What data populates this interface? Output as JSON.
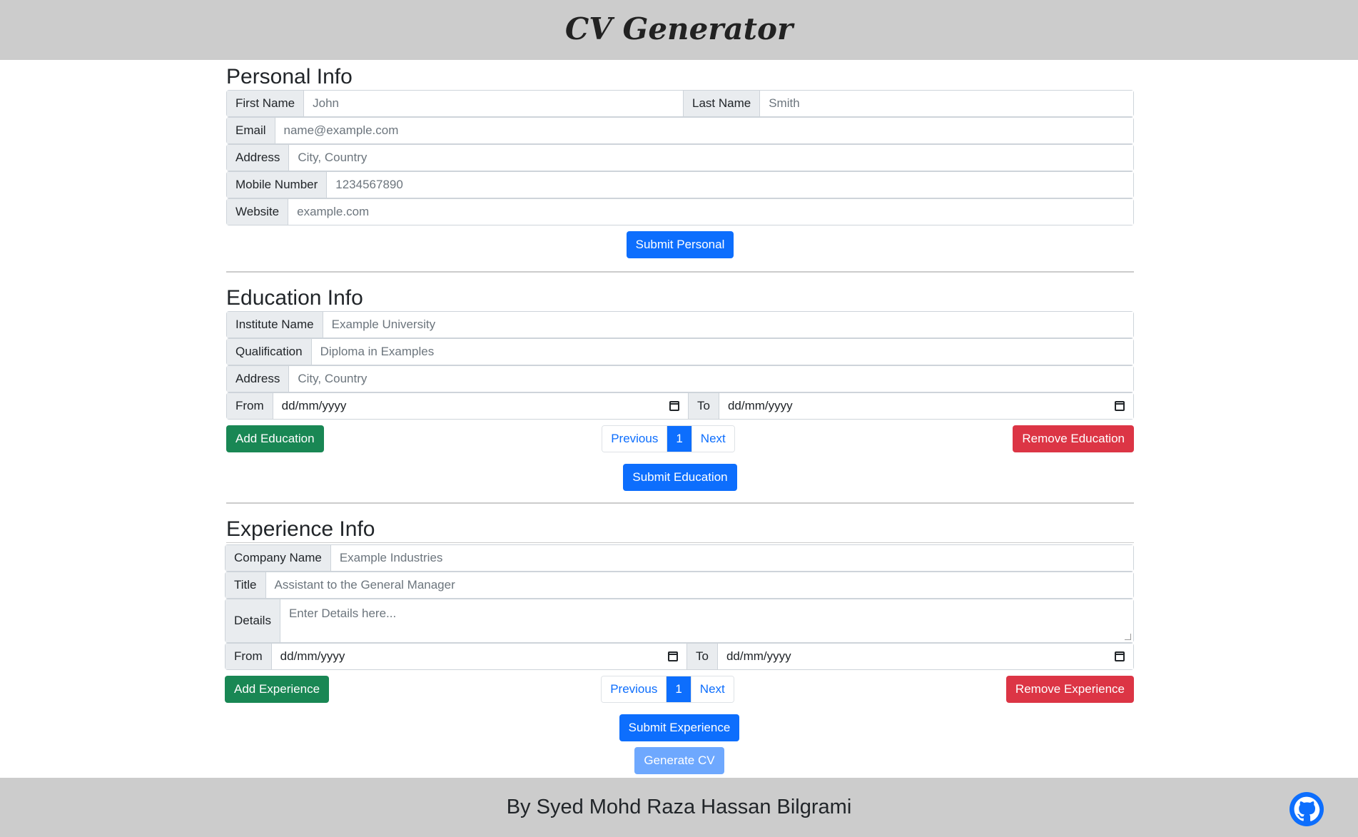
{
  "header": {
    "title": "CV Generator"
  },
  "personal": {
    "title": "Personal Info",
    "first_name_label": "First Name",
    "first_name_placeholder": "John",
    "last_name_label": "Last Name",
    "last_name_placeholder": "Smith",
    "email_label": "Email",
    "email_placeholder": "name@example.com",
    "address_label": "Address",
    "address_placeholder": "City, Country",
    "mobile_label": "Mobile Number",
    "mobile_placeholder": "1234567890",
    "website_label": "Website",
    "website_placeholder": "example.com",
    "submit_label": "Submit Personal"
  },
  "education": {
    "title": "Education Info",
    "institute_label": "Institute Name",
    "institute_placeholder": "Example University",
    "qualification_label": "Qualification",
    "qualification_placeholder": "Diploma in Examples",
    "address_label": "Address",
    "address_placeholder": "City, Country",
    "from_label": "From",
    "from_value": "dd/mm/yyyy",
    "to_label": "To",
    "to_value": "dd/mm/yyyy",
    "add_label": "Add Education",
    "pager": {
      "previous": "Previous",
      "current": "1",
      "next": "Next"
    },
    "remove_label": "Remove Education",
    "submit_label": "Submit Education"
  },
  "experience": {
    "title": "Experience Info",
    "company_label": "Company Name",
    "company_placeholder": "Example Industries",
    "title_label": "Title",
    "title_placeholder": "Assistant to the General Manager",
    "details_label": "Details",
    "details_placeholder": "Enter Details here...",
    "from_label": "From",
    "from_value": "dd/mm/yyyy",
    "to_label": "To",
    "to_value": "dd/mm/yyyy",
    "add_label": "Add Experience",
    "pager": {
      "previous": "Previous",
      "current": "1",
      "next": "Next"
    },
    "remove_label": "Remove Experience",
    "submit_label": "Submit Experience"
  },
  "generate_label": "Generate CV",
  "footer": {
    "text": "By Syed Mohd Raza Hassan Bilgrami",
    "icon": "github-icon"
  },
  "colors": {
    "primary": "#0d6efd",
    "success": "#198754",
    "danger": "#dc3545",
    "bar": "#cccccc",
    "disabled": "#6ea8fe"
  }
}
